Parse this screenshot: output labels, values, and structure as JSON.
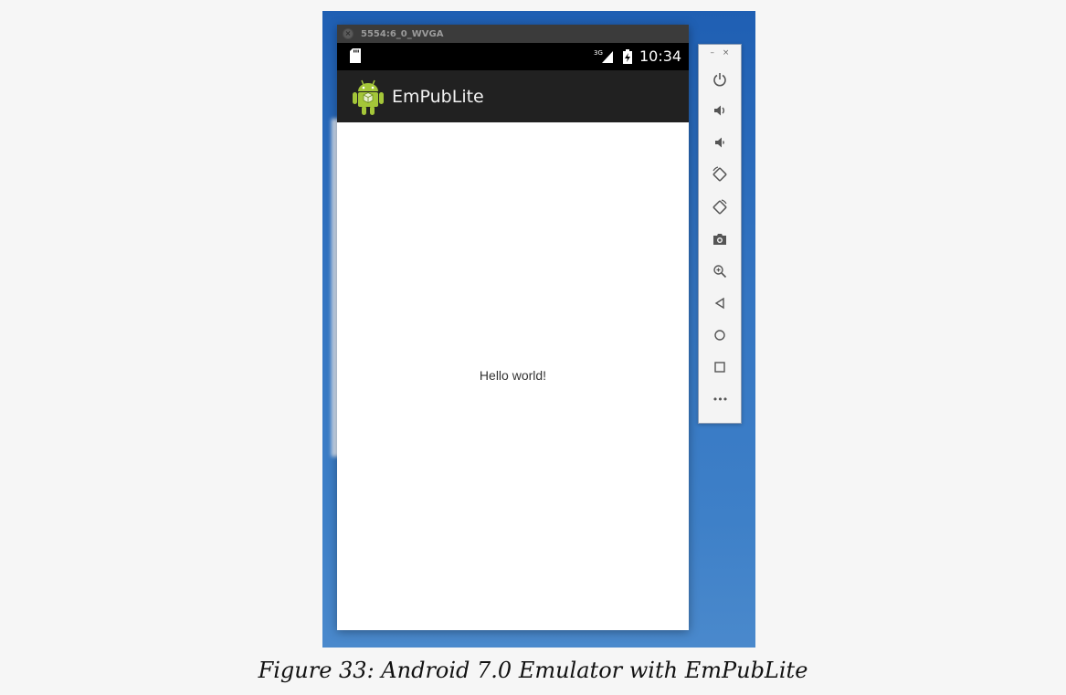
{
  "window": {
    "title": "5554:6_0_WVGA"
  },
  "status_bar": {
    "network": "3G",
    "time": "10:34"
  },
  "app": {
    "title": "EmPubLite",
    "content_text": "Hello world!"
  },
  "toolbar": {
    "minimize": "–",
    "close": "×",
    "buttons": [
      {
        "name": "power-icon"
      },
      {
        "name": "volume-up-icon"
      },
      {
        "name": "volume-down-icon"
      },
      {
        "name": "rotate-left-icon"
      },
      {
        "name": "rotate-right-icon"
      },
      {
        "name": "camera-icon"
      },
      {
        "name": "zoom-icon"
      },
      {
        "name": "back-icon"
      },
      {
        "name": "home-icon"
      },
      {
        "name": "overview-icon"
      },
      {
        "name": "more-icon",
        "label": "•••"
      }
    ]
  },
  "caption": "Figure 33: Android 7.0 Emulator with EmPubLite",
  "colors": {
    "desktop": "#2f6fbf",
    "status_bar": "#000000",
    "action_bar": "#212121",
    "android_green": "#a4c639"
  }
}
